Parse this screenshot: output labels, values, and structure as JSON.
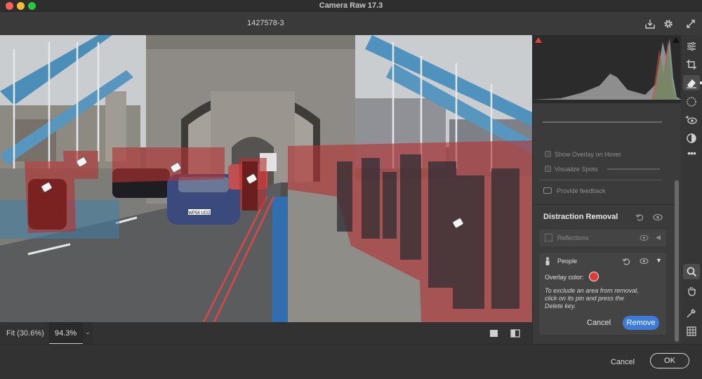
{
  "window": {
    "title": "Camera Raw 17.3",
    "file_name": "1427578-3"
  },
  "zoom": {
    "fit_label": "Fit (30.6%)",
    "value": "94.3%"
  },
  "panel": {
    "show_overlay_label": "Show Overlay on Hover",
    "visualize_spots_label": "Visualize Spots",
    "provide_feedback_label": "Provide feedback",
    "section_title": "Distraction Removal",
    "reflections_label": "Reflections",
    "people_label": "People",
    "overlay_color_label": "Overlay color:",
    "overlay_color": "#e53935",
    "help_text_1": "To exclude an area from removal,",
    "help_text_2": "click on its pin and press the",
    "help_text_3": "Delete key.",
    "cancel_label": "Cancel",
    "remove_label": "Remove"
  },
  "footer": {
    "cancel_label": "Cancel",
    "ok_label": "OK"
  },
  "photo": {
    "license_plate": "WP58 UCG"
  },
  "colors": {
    "accent": "#3a7bdc",
    "overlay": "#b43232"
  }
}
